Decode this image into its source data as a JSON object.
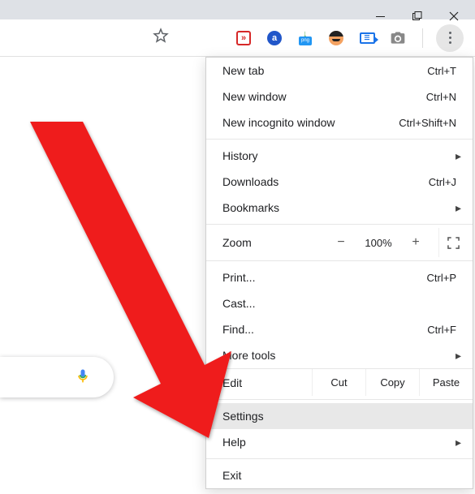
{
  "window": {
    "min": "minimize",
    "max": "maximize",
    "close": "close"
  },
  "extensions": [
    {
      "name": "forward-ext-icon"
    },
    {
      "name": "a-ext-icon"
    },
    {
      "name": "download-ext-icon"
    },
    {
      "name": "face-ext-icon"
    },
    {
      "name": "tag-ext-icon"
    },
    {
      "name": "camera-ext-icon"
    }
  ],
  "menu": {
    "new_tab": {
      "label": "New tab",
      "shortcut": "Ctrl+T"
    },
    "new_window": {
      "label": "New window",
      "shortcut": "Ctrl+N"
    },
    "new_incognito": {
      "label": "New incognito window",
      "shortcut": "Ctrl+Shift+N"
    },
    "history": {
      "label": "History"
    },
    "downloads": {
      "label": "Downloads",
      "shortcut": "Ctrl+J"
    },
    "bookmarks": {
      "label": "Bookmarks"
    },
    "zoom": {
      "label": "Zoom",
      "value": "100%",
      "minus": "−",
      "plus": "+"
    },
    "print": {
      "label": "Print...",
      "shortcut": "Ctrl+P"
    },
    "cast": {
      "label": "Cast..."
    },
    "find": {
      "label": "Find...",
      "shortcut": "Ctrl+F"
    },
    "more_tools": {
      "label": "More tools"
    },
    "edit": {
      "label": "Edit",
      "cut": "Cut",
      "copy": "Copy",
      "paste": "Paste"
    },
    "settings": {
      "label": "Settings"
    },
    "help": {
      "label": "Help"
    },
    "exit": {
      "label": "Exit"
    }
  },
  "annotation": {
    "arrow_points_to": "settings"
  }
}
